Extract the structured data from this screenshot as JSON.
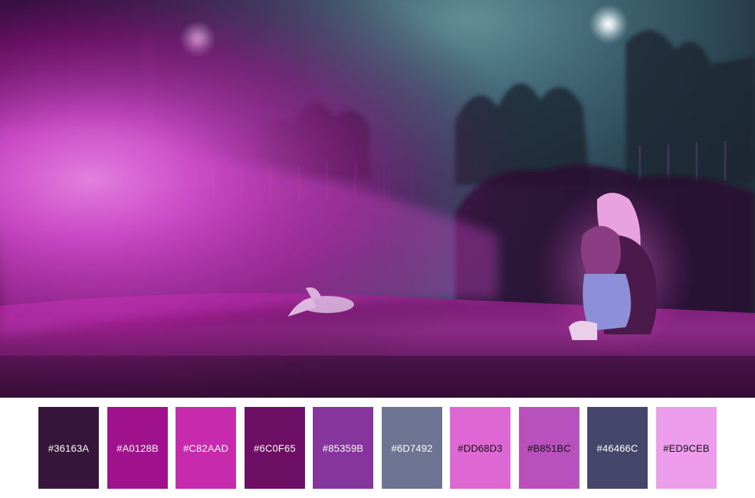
{
  "palette": {
    "swatches": [
      {
        "hex": "#36163A",
        "label": "#36163A",
        "light": false
      },
      {
        "hex": "#A0128B",
        "label": "#A0128B",
        "light": false
      },
      {
        "hex": "#C82AAD",
        "label": "#C82AAD",
        "light": false
      },
      {
        "hex": "#6C0F65",
        "label": "#6C0F65",
        "light": false
      },
      {
        "hex": "#85359B",
        "label": "#85359B",
        "light": false
      },
      {
        "hex": "#6D7492",
        "label": "#6D7492",
        "light": false
      },
      {
        "hex": "#DD68D3",
        "label": "#DD68D3",
        "light": true
      },
      {
        "hex": "#B851BC",
        "label": "#B851BC",
        "light": true
      },
      {
        "hex": "#46466C",
        "label": "#46466C",
        "light": false
      },
      {
        "hex": "#ED9CEB",
        "label": "#ED9CEB",
        "light": true
      }
    ]
  }
}
